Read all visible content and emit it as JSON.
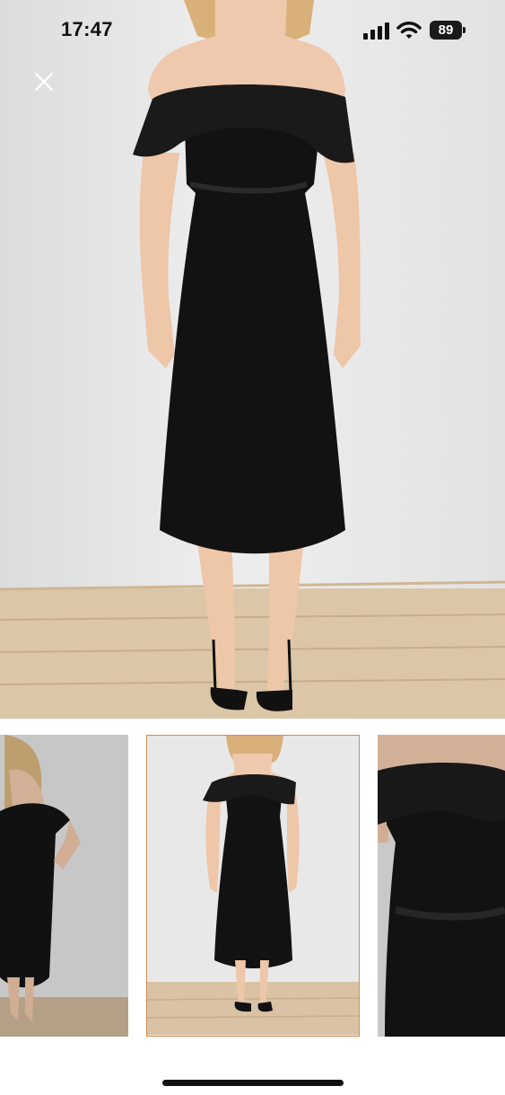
{
  "status_bar": {
    "time": "17:47",
    "battery_level": "89",
    "icons": [
      "cellular-signal-icon",
      "wifi-icon",
      "battery-icon"
    ]
  },
  "close_icon": "close-icon",
  "gallery": {
    "main_image": "product-photo",
    "selected_index": 1,
    "thumbnails": [
      {
        "name": "thumbnail-side-pose"
      },
      {
        "name": "thumbnail-front-full"
      },
      {
        "name": "thumbnail-closeup"
      }
    ],
    "accent_color": "#d08a5a"
  },
  "colors": {
    "dress": "#111111",
    "floor": "#d8c1a2",
    "wall": "#e8e8e8"
  }
}
